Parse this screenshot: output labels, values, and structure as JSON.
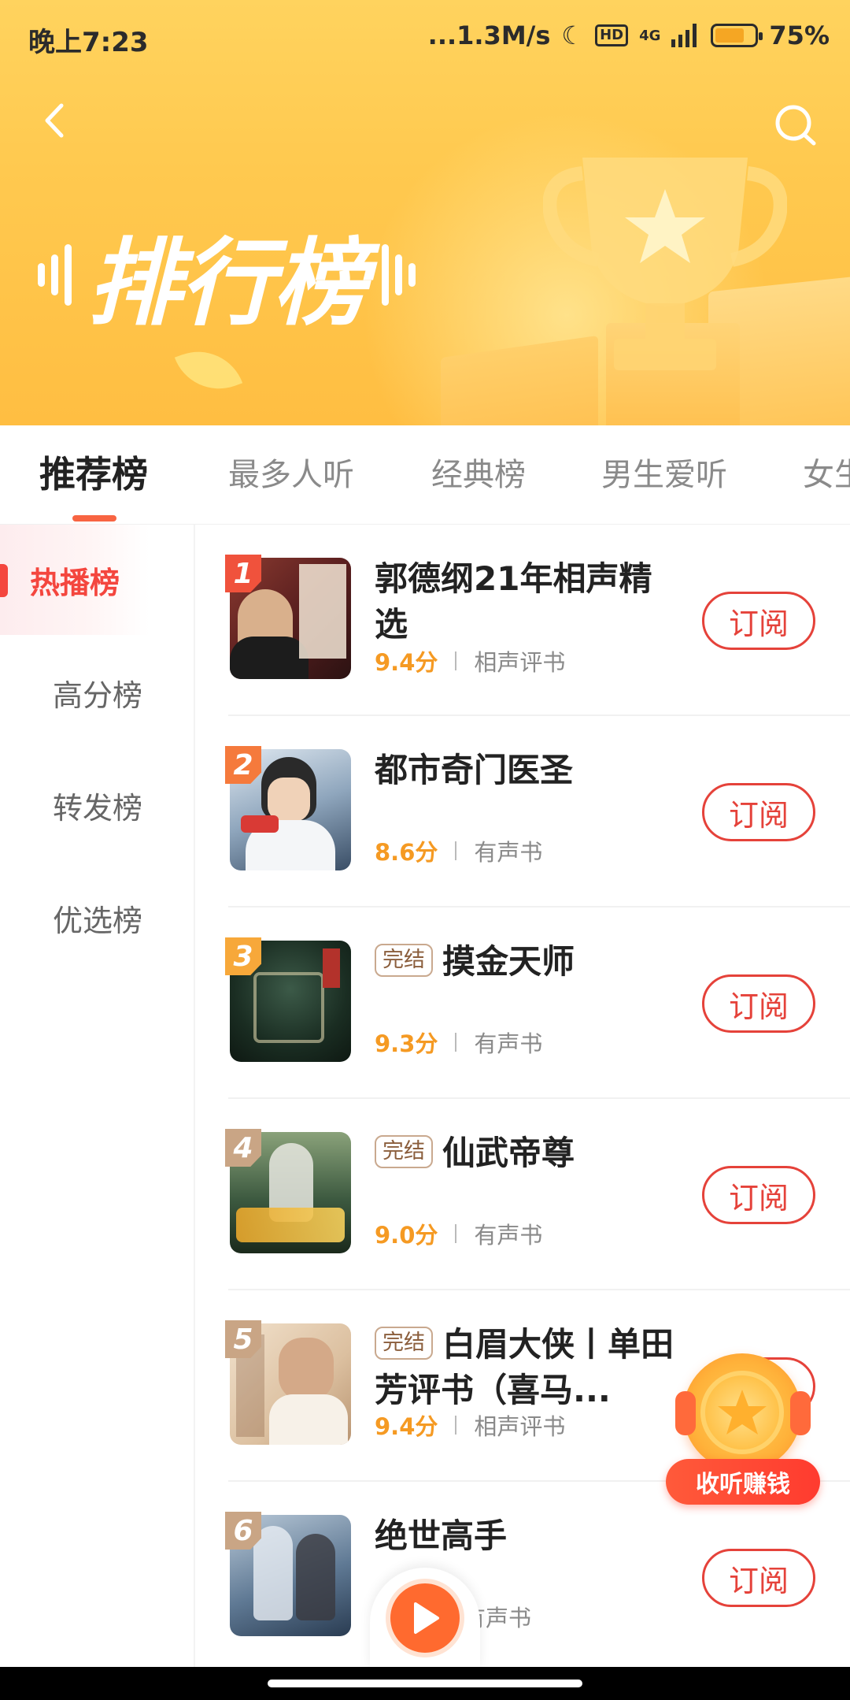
{
  "status_bar": {
    "time": "晚上7:23",
    "network_speed": "...1.3M/s",
    "hd": "HD",
    "signal": "4G",
    "battery": "75%"
  },
  "header": {
    "title": "排行榜",
    "back_icon": "chevron-left-icon",
    "search_icon": "search-icon"
  },
  "tabs": [
    {
      "label": "推荐榜",
      "active": true
    },
    {
      "label": "最多人听",
      "active": false
    },
    {
      "label": "经典榜",
      "active": false
    },
    {
      "label": "男生爱听",
      "active": false
    },
    {
      "label": "女生",
      "active": false
    }
  ],
  "sidebar": {
    "items": [
      {
        "label": "热播榜",
        "active": true
      },
      {
        "label": "高分榜",
        "active": false
      },
      {
        "label": "转发榜",
        "active": false
      },
      {
        "label": "优选榜",
        "active": false
      }
    ]
  },
  "list": {
    "subscribe_label": "订阅",
    "items": [
      {
        "rank": "1",
        "title": "郭德纲21年相声精选",
        "badge": "",
        "score": "9.4分",
        "category": "相声评书",
        "rank_color": "#f0523c",
        "cover": "#6a2a2a"
      },
      {
        "rank": "2",
        "title": "都市奇门医圣",
        "badge": "",
        "score": "8.6分",
        "category": "有声书",
        "rank_color": "#f57a3c",
        "cover": "#4a5f7a"
      },
      {
        "rank": "3",
        "title": "摸金天师",
        "badge": "完结",
        "score": "9.3分",
        "category": "有声书",
        "rank_color": "#f7a83a",
        "cover": "#1f3a2c"
      },
      {
        "rank": "4",
        "title": "仙武帝尊",
        "badge": "完结",
        "score": "9.0分",
        "category": "有声书",
        "rank_color": "#c9a585",
        "cover": "#2c4a34"
      },
      {
        "rank": "5",
        "title": "白眉大侠丨单田芳评书（喜马...",
        "badge": "完结",
        "score": "9.4分",
        "category": "相声评书",
        "rank_color": "#c9a585",
        "cover": "#c9a27a"
      },
      {
        "rank": "6",
        "title": "绝世高手",
        "badge": "",
        "score": "",
        "category": "有声书",
        "rank_color": "#c9a585",
        "cover": "#4d6a88"
      }
    ]
  },
  "reward": {
    "label": "收听赚钱"
  },
  "colors": {
    "accent": "#f4463e",
    "score": "#f59a23",
    "banner": "#ffc94f"
  }
}
